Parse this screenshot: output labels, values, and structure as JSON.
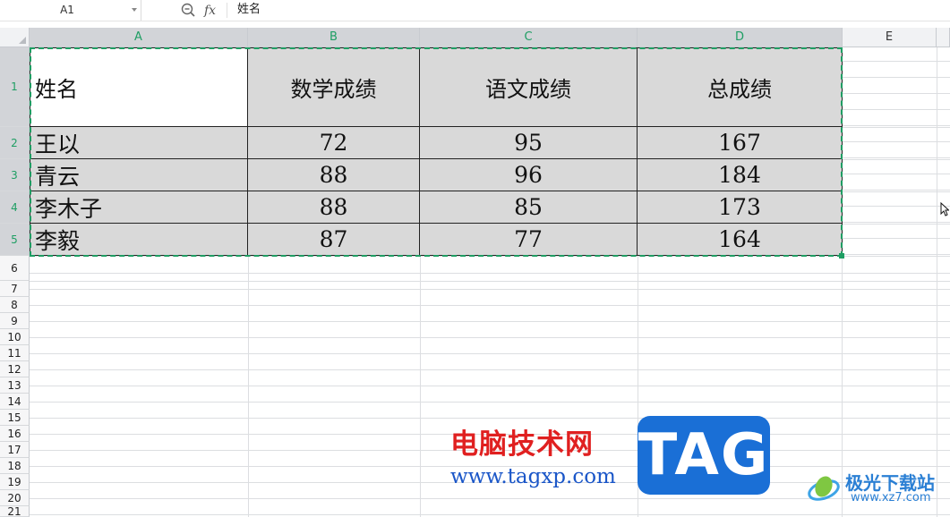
{
  "formula_bar": {
    "cell_ref": "A1",
    "fx_label": "fx",
    "content": "姓名"
  },
  "columns": [
    {
      "label": "A",
      "selected": true
    },
    {
      "label": "B",
      "selected": true
    },
    {
      "label": "C",
      "selected": true
    },
    {
      "label": "D",
      "selected": true
    },
    {
      "label": "E",
      "selected": false
    }
  ],
  "rows": [
    "1",
    "2",
    "3",
    "4",
    "5",
    "6",
    "7",
    "8",
    "9",
    "10",
    "11",
    "12",
    "13",
    "14",
    "15",
    "16",
    "17",
    "18",
    "19",
    "20",
    "21"
  ],
  "table": {
    "headers": [
      "姓名",
      "数学成绩",
      "语文成绩",
      "总成绩"
    ],
    "data": [
      [
        "王以",
        "72",
        "95",
        "167"
      ],
      [
        "青云",
        "88",
        "96",
        "184"
      ],
      [
        "李木子",
        "88",
        "85",
        "173"
      ],
      [
        "李毅",
        "87",
        "77",
        "164"
      ]
    ]
  },
  "watermark": {
    "title": "电脑技术网",
    "url": "www.tagxp.com",
    "tag": "TAG",
    "site": "极光下载站",
    "site_url": "www.xz7.com"
  },
  "colors": {
    "selection": "#1e9e63",
    "cell_fill": "#d9d9d9"
  }
}
